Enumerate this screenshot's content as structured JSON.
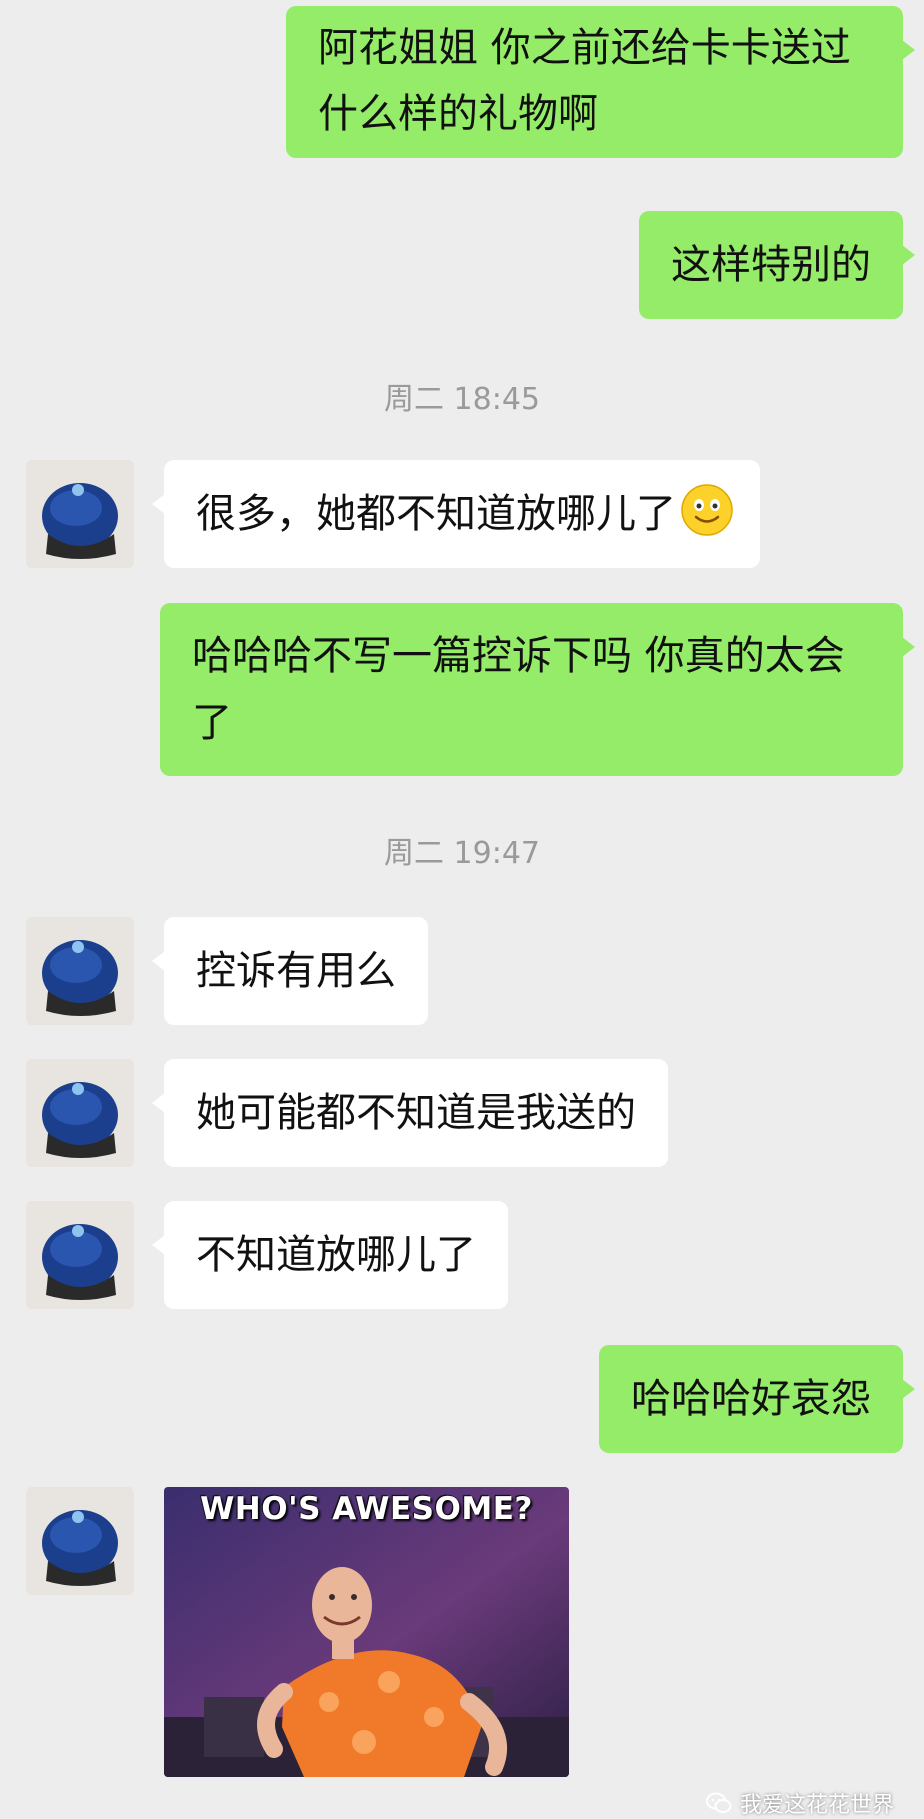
{
  "colors": {
    "background": "#ededed",
    "sent_bubble": "#95ec69",
    "received_bubble": "#ffffff",
    "timestamp": "#9a9a9a"
  },
  "messages": [
    {
      "side": "sent",
      "text": "阿花姐姐 你之前还给卡卡送过什么样的礼物啊"
    },
    {
      "side": "sent",
      "text": "这样特别的"
    },
    {
      "type": "timestamp",
      "text": "周二 18:45"
    },
    {
      "side": "received",
      "text": "很多，她都不知道放哪儿了",
      "emoji": "smile-emoji"
    },
    {
      "side": "sent",
      "text": "哈哈哈不写一篇控诉下吗 你真的太会了"
    },
    {
      "type": "timestamp",
      "text": "周二 19:47"
    },
    {
      "side": "received",
      "text": "控诉有用么"
    },
    {
      "side": "received",
      "text": "她可能都不知道是我送的"
    },
    {
      "side": "received",
      "text": "不知道放哪儿了"
    },
    {
      "side": "sent",
      "text": "哈哈哈好哀怨"
    },
    {
      "side": "received",
      "type": "image",
      "caption": "WHO'S AWESOME?"
    }
  ],
  "watermark": {
    "text": "我爱这花花世界",
    "icon": "wechat-icon"
  }
}
